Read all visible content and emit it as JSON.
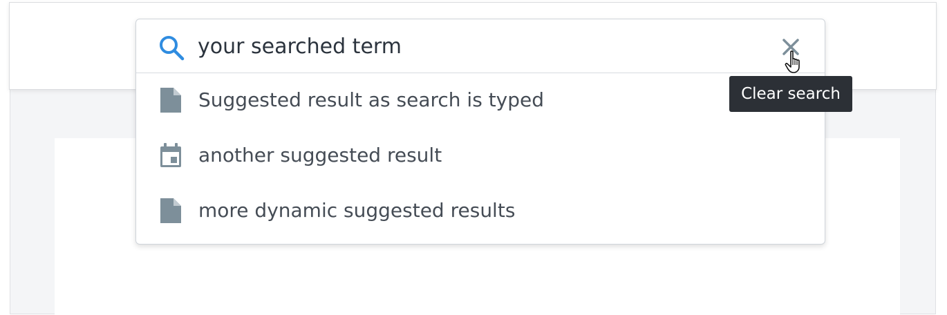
{
  "search": {
    "value": "your searched term",
    "clear_tooltip": "Clear search"
  },
  "suggestions": [
    {
      "label": "Suggested result as search is typed",
      "icon": "file-icon"
    },
    {
      "label": "another suggested result",
      "icon": "calendar-icon"
    },
    {
      "label": "more dynamic suggested results",
      "icon": "file-icon"
    }
  ],
  "colors": {
    "accent": "#2f8ce0",
    "icon_gray": "#7d8f9a",
    "tooltip_bg": "#2c3036",
    "text": "#454c55"
  }
}
